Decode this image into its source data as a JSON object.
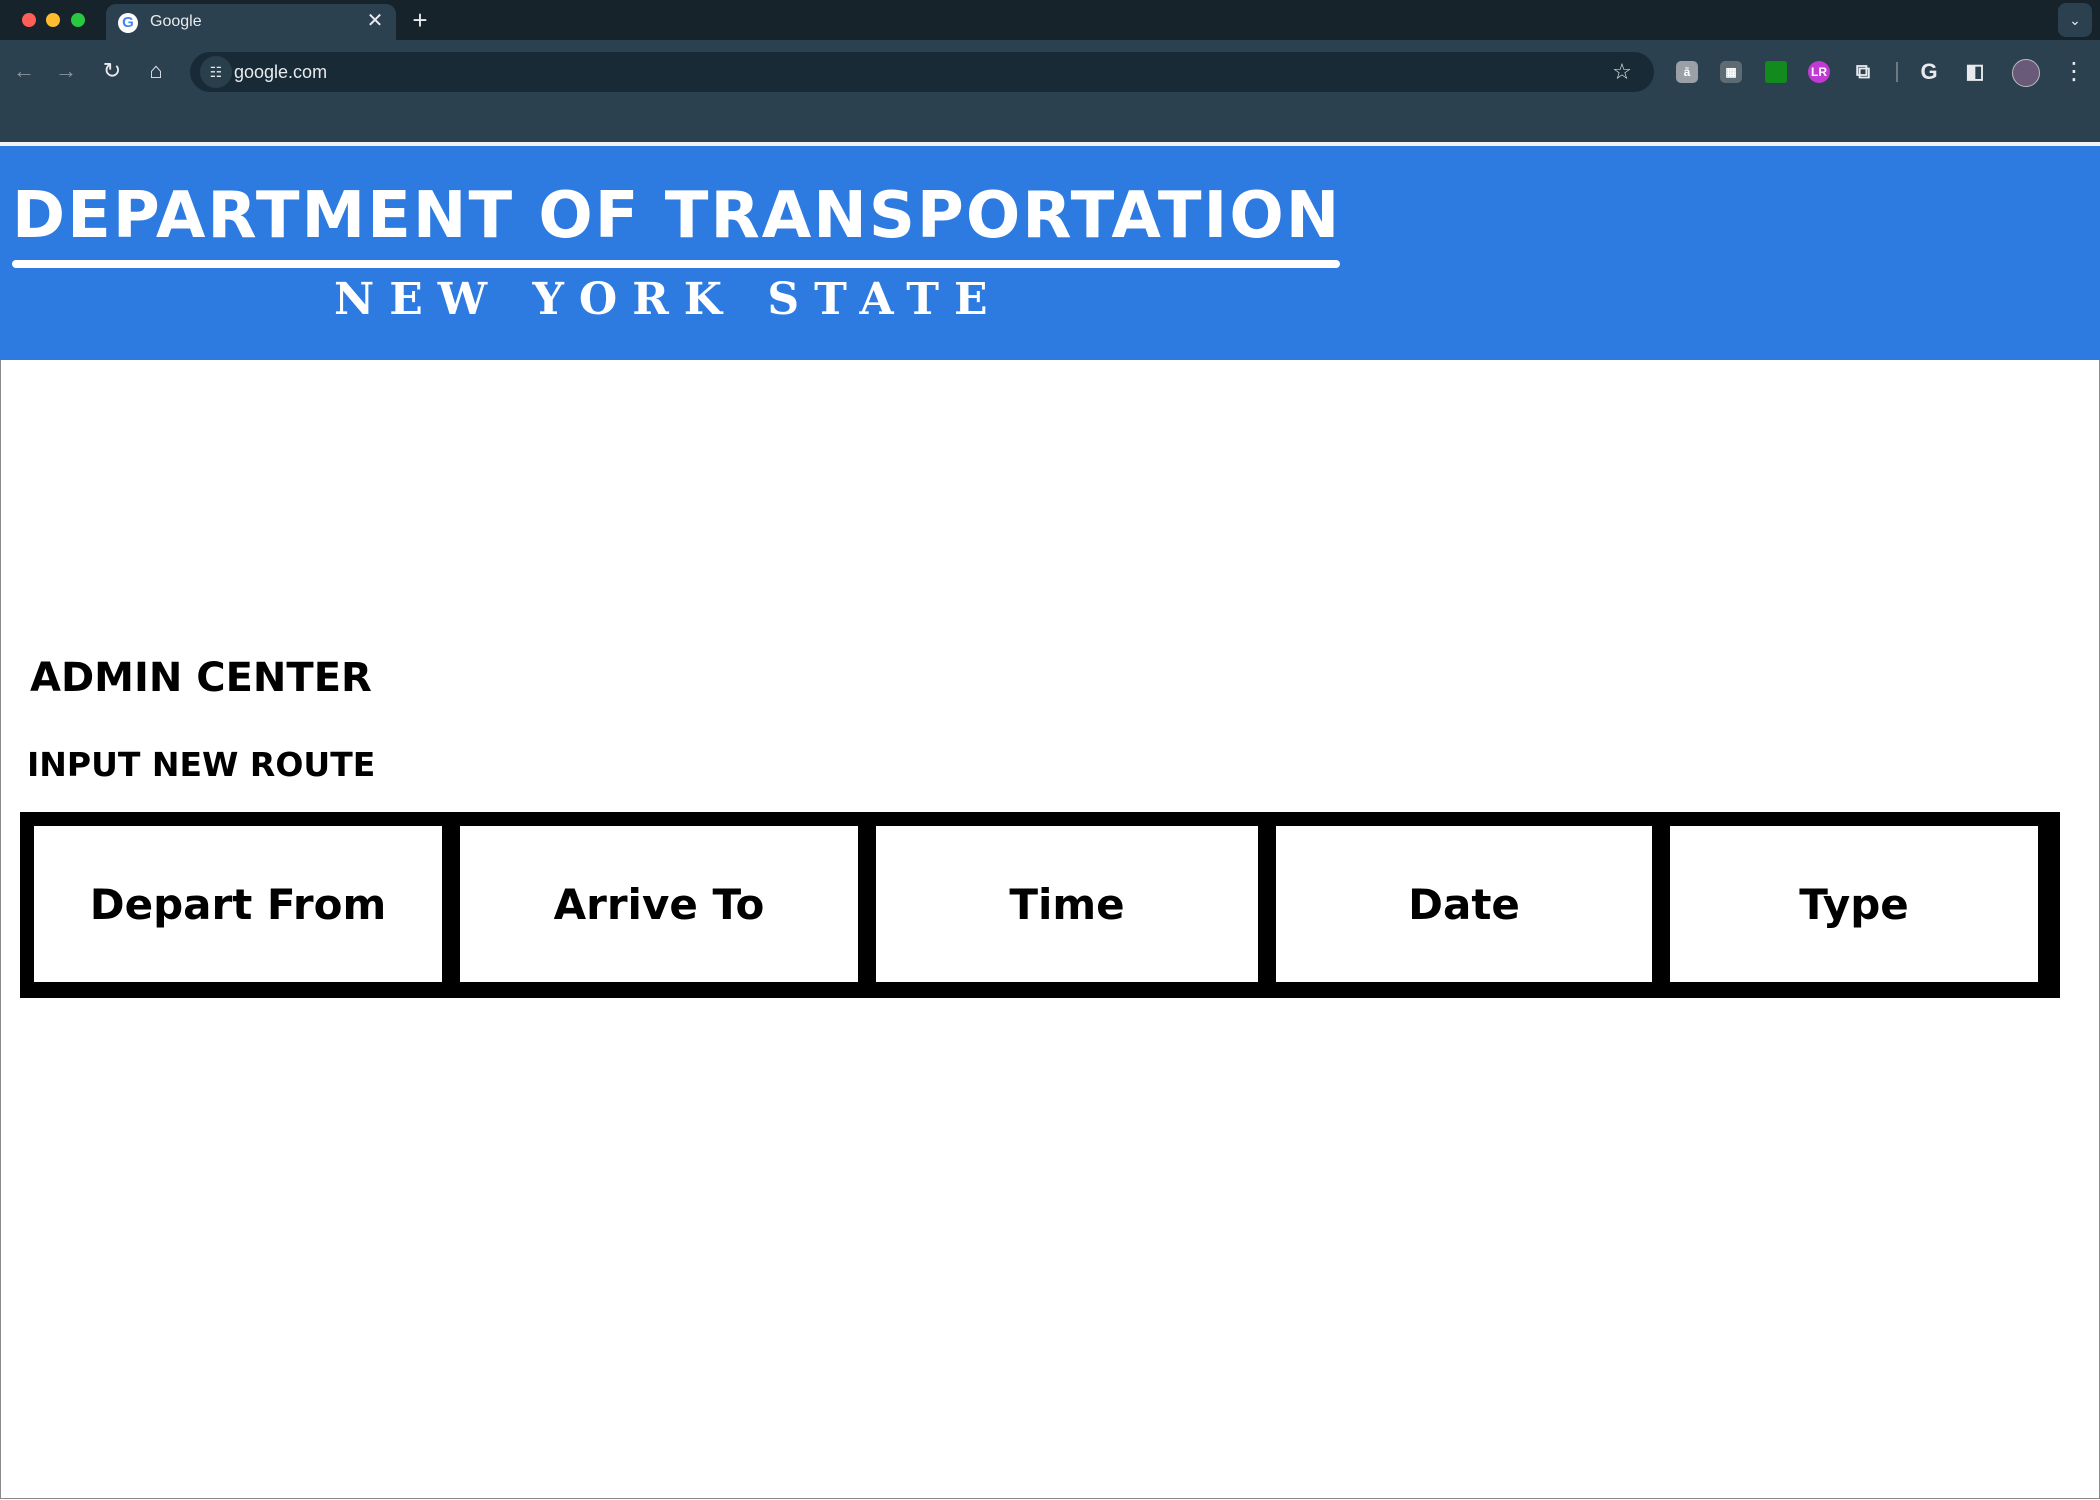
{
  "browser": {
    "tab_title": "Google",
    "tab_favicon_letter": "G",
    "tab_close_glyph": "✕",
    "new_tab_glyph": "+",
    "tab_search_glyph": "⌄",
    "url": "google.com",
    "nav": {
      "back_glyph": "←",
      "forward_glyph": "→",
      "reload_glyph": "↻",
      "home_glyph": "⌂"
    },
    "star_glyph": "☆",
    "menu_glyph": "⋮",
    "extensions": [
      {
        "icon": "translate-extension-icon",
        "glyph": "ā"
      },
      {
        "icon": "grid-extension-icon",
        "glyph": "▦"
      },
      {
        "icon": "green-extension-icon",
        "glyph": ""
      },
      {
        "icon": "lr-extension-icon",
        "glyph": "LR"
      },
      {
        "icon": "puzzle-extensions-icon",
        "glyph": "⧉"
      },
      {
        "icon": "google-g-icon",
        "glyph": "G"
      },
      {
        "icon": "side-panel-icon",
        "glyph": "◧"
      }
    ]
  },
  "banner": {
    "title": "DEPARTMENT OF TRANSPORTATION",
    "subtitle": "NEW YORK STATE",
    "background_color": "#2d7be0"
  },
  "admin": {
    "title": "ADMIN CENTER",
    "section_title": "INPUT NEW ROUTE",
    "route_columns": [
      "Depart From",
      "Arrive To",
      "Time",
      "Date",
      "Type"
    ]
  }
}
